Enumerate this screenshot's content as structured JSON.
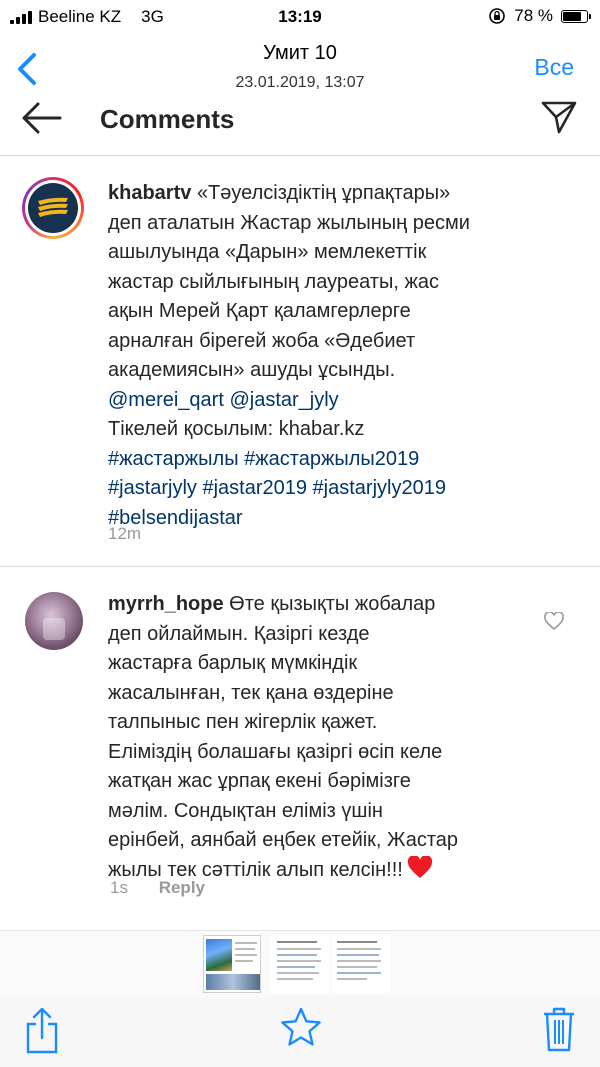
{
  "status_bar": {
    "carrier": "Beeline KZ",
    "network": "3G",
    "time": "13:19",
    "battery_text": "78 %",
    "battery_level": 0.78
  },
  "viewer": {
    "title": "Умит 10",
    "subtitle": "23.01.2019, 13:07",
    "all_button": "Все"
  },
  "ig_header": {
    "title": "Comments"
  },
  "caption": {
    "username": "khabartv",
    "lines": [
      "«Тәуелсіздіктің ұрпақтары»",
      "деп аталатын  Жастар жылының ресми",
      "ашылуында «Дарын» мемлекеттік",
      "жастар сыйлығының лауреаты, жас",
      "ақын Мерей Қарт қаламгерлерге",
      "арналған бірегей жоба «Әдебиет",
      "академиясын» ашуды ұсынды."
    ],
    "mentions": "@merei_qart @jastar_jyly",
    "live_line": "Тікелей қосылым: khabar.kz",
    "hashtags": [
      "#жастаржылы #жастаржылы2019",
      "#jastarjyly #jastar2019  #jastarjyly2019",
      "#belsendijastar"
    ],
    "time": "12m"
  },
  "comment": {
    "username": "myrrh_hope",
    "first_line": "Өте қызықты жобалар",
    "lines": [
      "деп ойлаймын. Қазіргі кезде",
      "жастарға барлық мүмкіндік",
      "жасалынған, тек қана өздеріне",
      "талпыныс пен жігерлік қажет.",
      "Еліміздің болашағы қазіргі өсіп келе",
      "жатқан жас ұрпақ екені бәрімізге",
      "мәлім. Сондықтан еліміз үшін",
      "ерінбей, аянбай еңбек етейік, Жастар"
    ],
    "last_line": "жылы тек сәттілік алып келсін!!!",
    "time": "1s",
    "reply_label": "Reply"
  },
  "colors": {
    "ios_blue": "#1a8cff",
    "ig_link": "#003569",
    "heart_red": "#ed1c24"
  },
  "icons": {
    "status": [
      "signal-icon",
      "rotation-lock-icon",
      "battery-icon"
    ],
    "viewer": [
      "back-chevron-icon"
    ],
    "ig": [
      "back-arrow-icon",
      "send-icon",
      "heart-outline-icon",
      "heart-red-icon"
    ],
    "toolbar": [
      "share-icon",
      "star-icon",
      "trash-icon"
    ]
  }
}
